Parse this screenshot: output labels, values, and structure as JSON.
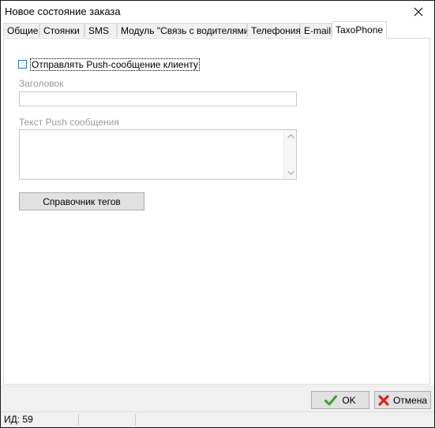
{
  "window": {
    "title": "Новое состояние заказа"
  },
  "tabs": [
    {
      "label": "Общие"
    },
    {
      "label": "Стоянки"
    },
    {
      "label": "SMS"
    },
    {
      "label": "Модуль \"Связь с водителями\""
    },
    {
      "label": "Телефония"
    },
    {
      "label": "E-mail"
    },
    {
      "label": "TaxoPhone"
    }
  ],
  "active_tab": "TaxoPhone",
  "taxophone": {
    "push_checkbox_label": "Отправлять Push-сообщение клиенту",
    "push_checked": false,
    "header_label": "Заголовок",
    "header_value": "",
    "push_text_label": "Текст Push сообщения",
    "push_text_value": "",
    "tags_button_label": "Справочник тегов"
  },
  "buttons": {
    "ok_label": "OK",
    "cancel_label": "Отмена"
  },
  "status": {
    "id_text": "ИД: 59"
  },
  "colors": {
    "ok_check": "#3aa02a",
    "cancel_x": "#d9251c",
    "checkbox_border": "#1e6fc7"
  }
}
